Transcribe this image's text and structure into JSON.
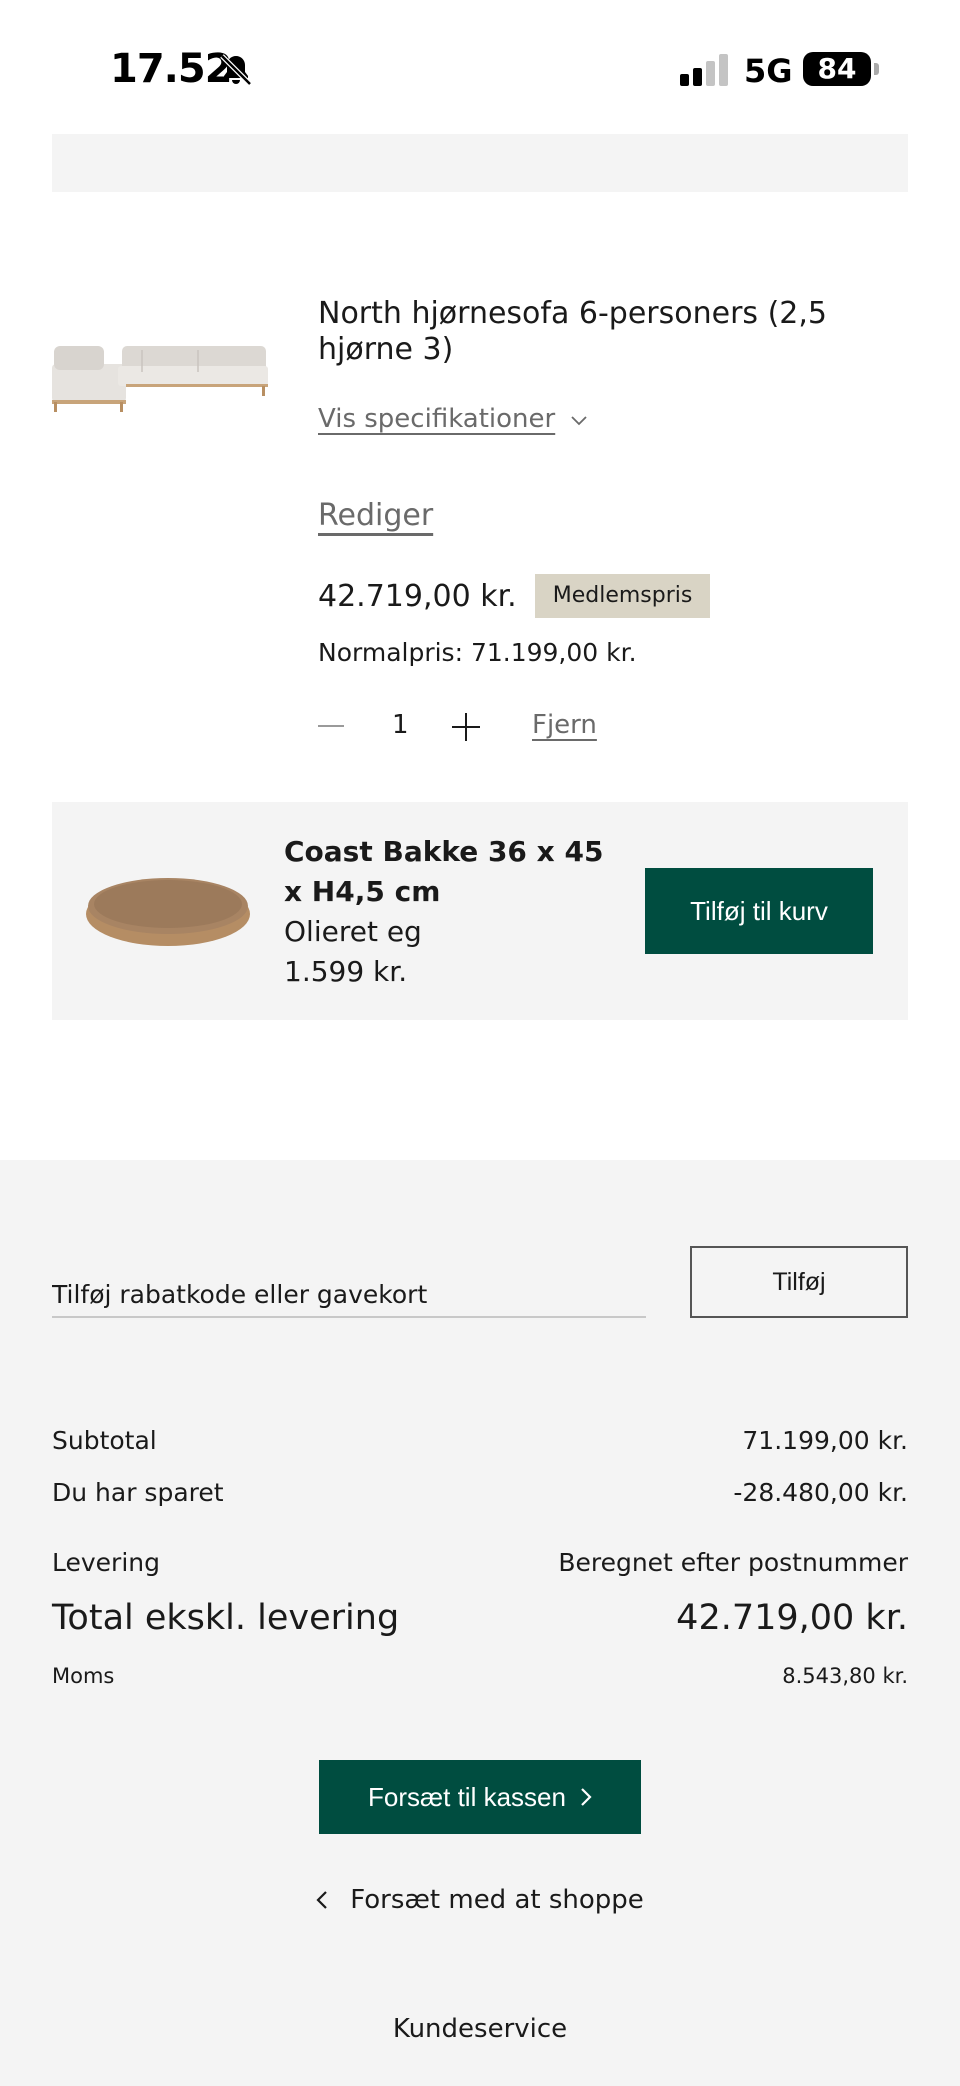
{
  "status_bar": {
    "time": "17.52",
    "network": "5G",
    "battery": "84"
  },
  "cart_item": {
    "title": "North hjørnesofa 6-personers (2,5 hjørne 3)",
    "spec_toggle": "Vis specifikationer",
    "edit_label": "Rediger",
    "price": "42.719,00 kr.",
    "member_badge": "Medlemspris",
    "normal_price": "Normalpris: 71.199,00 kr.",
    "quantity": "1",
    "remove_label": "Fjern"
  },
  "upsell": {
    "title": "Coast Bakke 36 x 45 x H4,5 cm",
    "variant": "Olieret eg",
    "price": "1.599 kr.",
    "add_button": "Tilføj til kurv"
  },
  "summary": {
    "discount_placeholder": "Tilføj rabatkode eller gavekort",
    "apply_button": "Tilføj",
    "subtotal_label": "Subtotal",
    "subtotal_value": "71.199,00 kr.",
    "saved_label": "Du har sparet",
    "saved_value": "-28.480,00 kr.",
    "delivery_label": "Levering",
    "delivery_value": "Beregnet efter postnummer",
    "total_label": "Total ekskl. levering",
    "total_value": "42.719,00 kr.",
    "vat_label": "Moms",
    "vat_value": "8.543,80 kr.",
    "checkout_button": "Forsæt til kassen",
    "continue_shopping": "Forsæt med at shoppe",
    "customer_service": "Kundeservice"
  },
  "colors": {
    "accent": "#004d40",
    "badge": "#d9d4c5",
    "panel": "#f4f4f4"
  },
  "icons": [
    "bell-slash-icon",
    "signal-icon",
    "chevron-down-icon",
    "minus-icon",
    "plus-icon",
    "chevron-right-icon",
    "chevron-left-icon"
  ]
}
